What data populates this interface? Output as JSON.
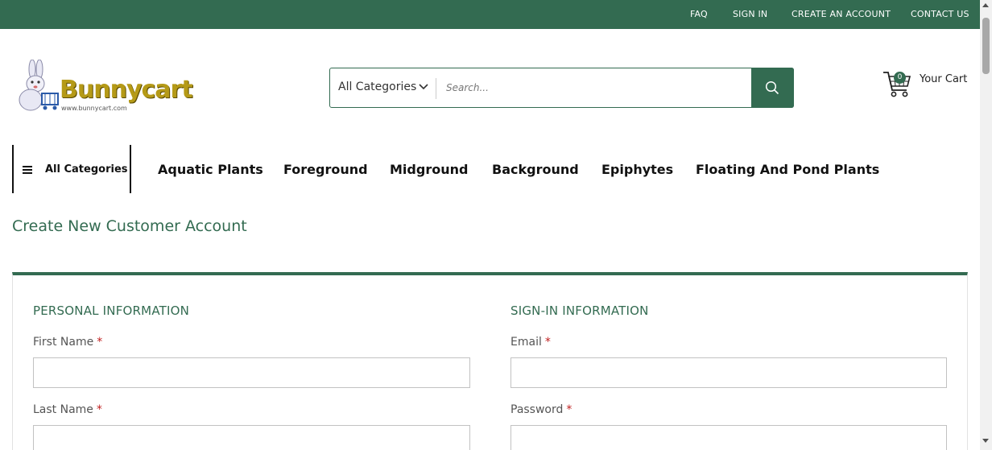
{
  "topbar": {
    "links": [
      "FAQ",
      "SIGN IN",
      "CREATE AN ACCOUNT",
      "CONTACT US"
    ]
  },
  "logo": {
    "name": "Bunnycart",
    "url_text": "www.bunnycart.com"
  },
  "search": {
    "category_label": "All Categories",
    "placeholder": "Search...",
    "value": "",
    "button_icon": "search-icon"
  },
  "cart": {
    "count": "0",
    "label": "Your Cart",
    "icon": "cart-icon"
  },
  "nav": {
    "all_categories": "All Categories",
    "items": [
      "Aquatic Plants",
      "Foreground",
      "Midground",
      "Background",
      "Epiphytes",
      "Floating And Pond Plants"
    ]
  },
  "page": {
    "title": "Create New Customer Account"
  },
  "form": {
    "personal": {
      "title": "PERSONAL INFORMATION",
      "first_name_label": "First Name",
      "last_name_label": "Last Name",
      "required_mark": "*"
    },
    "signin": {
      "title": "SIGN-IN INFORMATION",
      "email_label": "Email",
      "password_label": "Password",
      "required_mark": "*"
    }
  },
  "colors": {
    "brand_green": "#336b51",
    "required": "#c02020"
  }
}
